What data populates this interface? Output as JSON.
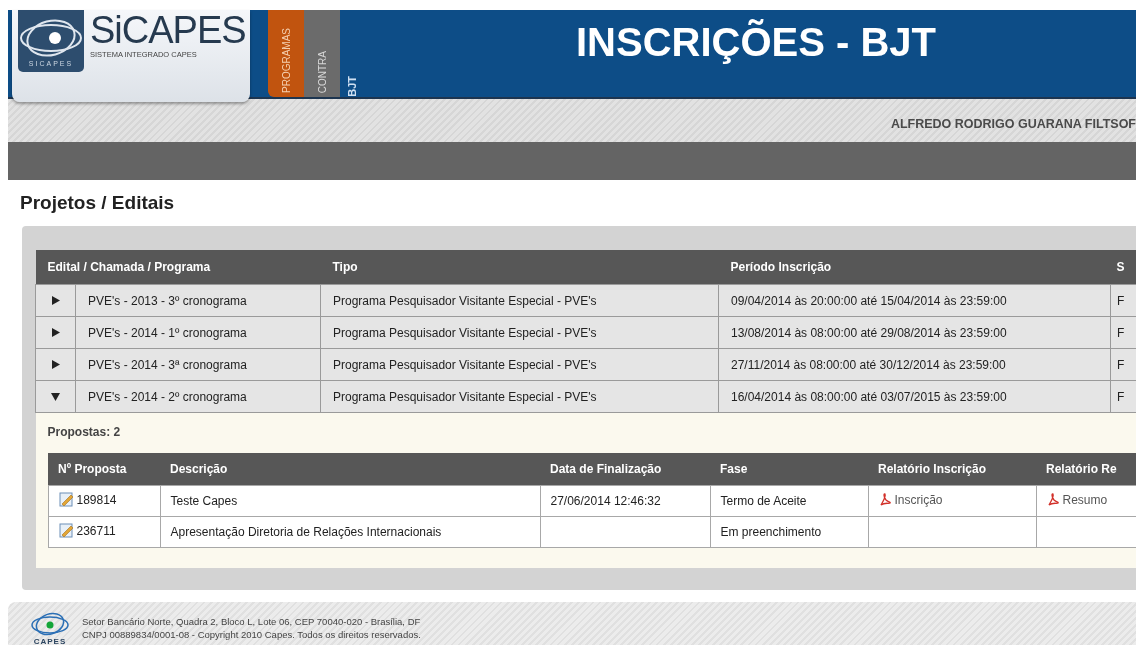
{
  "header": {
    "logo": {
      "title": "SiCAPES",
      "subtitle": "SISTEMA INTEGRADO CAPES",
      "emblem_label": "SICAPES"
    },
    "tabs": [
      {
        "label": "PROGRAMAS",
        "selected": true
      },
      {
        "label": "CONTRA",
        "selected": false
      }
    ],
    "context": "BJT",
    "page_title": "INSCRIÇÕES - BJT",
    "user_name": "ALFREDO RODRIGO GUARANA FILTSOF"
  },
  "section_title": "Projetos / Editais",
  "editais": {
    "columns": [
      "Edital / Chamada / Programa",
      "Tipo",
      "Período Inscrição",
      "S"
    ],
    "rows": [
      {
        "edital": "PVE's - 2013 - 3º cronograma",
        "tipo": "Programa Pesquisador Visitante Especial - PVE's",
        "periodo": "09/04/2014 às 20:00:00 até 15/04/2014 às 23:59:00",
        "column_4": "F",
        "expanded": false
      },
      {
        "edital": "PVE's - 2014 - 1º cronograma",
        "tipo": "Programa Pesquisador Visitante Especial - PVE's",
        "periodo": "13/08/2014 às 08:00:00 até 29/08/2014 às 23:59:00",
        "column_4": "F",
        "expanded": false
      },
      {
        "edital": "PVE's - 2014 - 3ª cronograma",
        "tipo": "Programa Pesquisador Visitante Especial - PVE's",
        "periodo": "27/11/2014 às 08:00:00 até 30/12/2014 às 23:59:00",
        "column_4": "F",
        "expanded": false
      },
      {
        "edital": "PVE's - 2014 - 2º cronograma",
        "tipo": "Programa Pesquisador Visitante Especial - PVE's",
        "periodo": "16/04/2014 às 08:00:00 até 03/07/2015 às 23:59:00",
        "column_4": "F",
        "expanded": true,
        "propostas": {
          "count_label": "Propostas: 2",
          "columns": [
            "Nº Proposta",
            "Descrição",
            "Data de Finalização",
            "Fase",
            "Relatório Inscrição",
            "Relatório Re"
          ],
          "rows": [
            {
              "numero": "189814",
              "descricao": "Teste Capes",
              "data": "27/06/2014 12:46:32",
              "fase": "Termo de Aceite",
              "relatorio_inscricao": "Inscrição",
              "relatorio_resumo": "Resumo"
            },
            {
              "numero": "236711",
              "descricao": "Apresentação Diretoria de Relações Internacionais",
              "fase": "Em preenchimento"
            }
          ]
        }
      }
    ]
  },
  "footer": {
    "logo_label": "CAPES",
    "lines": [
      "Setor Bancário Norte, Quadra 2, Bloco L, Lote 06, CEP 70040-020 - Brasília, DF",
      "CNPJ 00889834/0001-08 - Copyright 2010 Capes. Todos os direitos reservados."
    ]
  }
}
